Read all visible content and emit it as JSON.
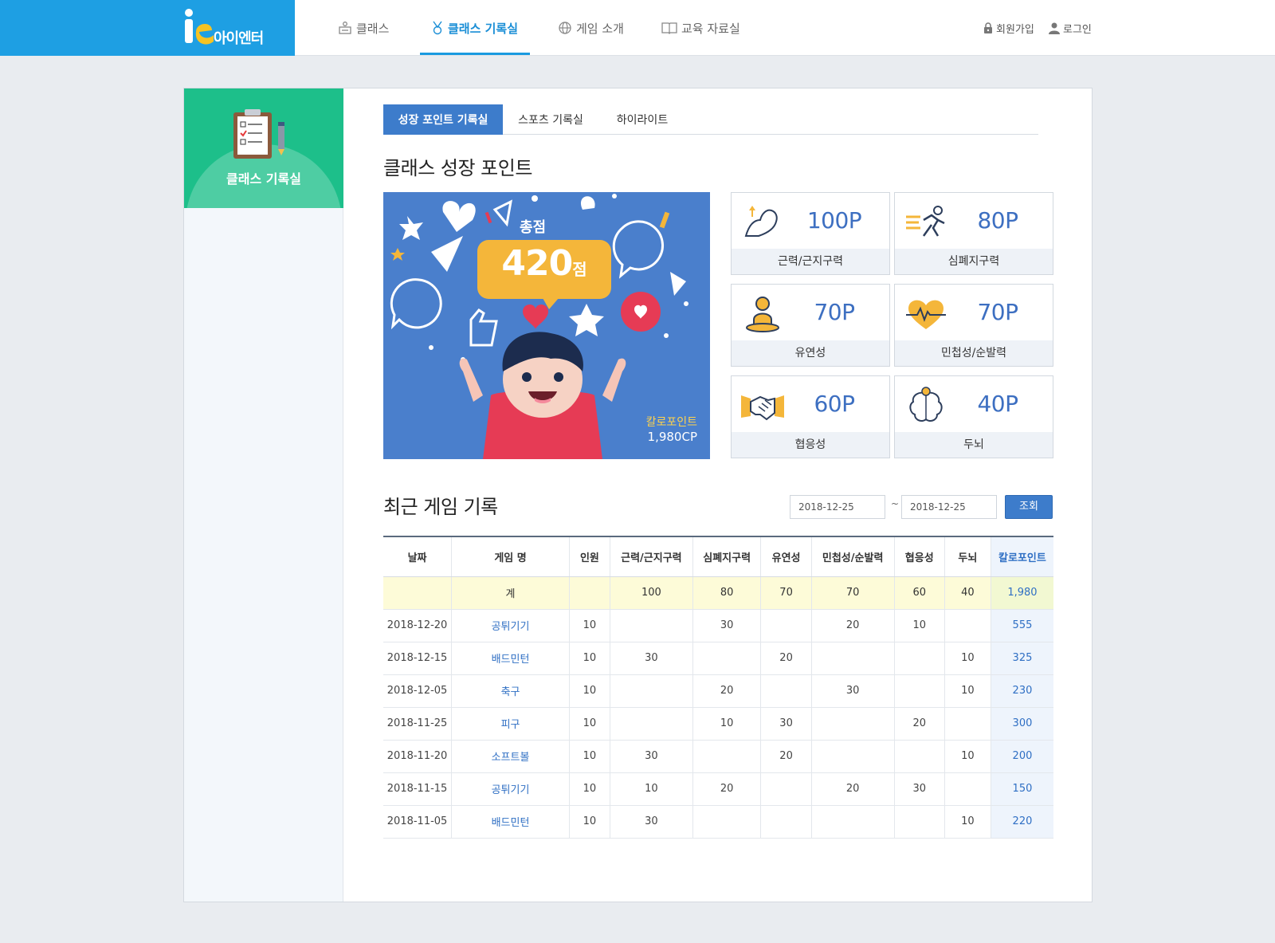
{
  "header": {
    "logo_text": "아이엔터",
    "nav": [
      {
        "label": "클래스",
        "icon": "classroom-icon"
      },
      {
        "label": "클래스 기록실",
        "icon": "medal-icon"
      },
      {
        "label": "게임 소개",
        "icon": "globe-icon"
      },
      {
        "label": "교육 자료실",
        "icon": "book-icon"
      }
    ],
    "util": {
      "signup": "회원가입",
      "login": "로그인"
    }
  },
  "sidebar": {
    "title": "클래스 기록실"
  },
  "tabs": [
    "성장 포인트 기록실",
    "스포츠 기록실",
    "하이라이트"
  ],
  "growth": {
    "title": "클래스 성장 포인트",
    "hero": {
      "total_label": "총점",
      "total_value": "420",
      "total_unit": "점",
      "cp_label": "칼로포인트",
      "cp_value": "1,980CP"
    },
    "stats": [
      {
        "value": "100P",
        "label": "근력/근지구력",
        "icon": "muscle-icon"
      },
      {
        "value": "80P",
        "label": "심폐지구력",
        "icon": "runner-icon"
      },
      {
        "value": "70P",
        "label": "유연성",
        "icon": "yoga-icon"
      },
      {
        "value": "70P",
        "label": "민첩성/순발력",
        "icon": "heartbeat-icon"
      },
      {
        "value": "60P",
        "label": "협응성",
        "icon": "handshake-icon"
      },
      {
        "value": "40P",
        "label": "두뇌",
        "icon": "brain-icon"
      }
    ]
  },
  "records": {
    "title": "최근 게임 기록",
    "date_from": "2018-12-25",
    "date_separator": "~",
    "date_to": "2018-12-25",
    "search_label": "조회",
    "columns": [
      "날짜",
      "게임 명",
      "인원",
      "근력/근지구력",
      "심폐지구력",
      "유연성",
      "민첩성/순발력",
      "협응성",
      "두뇌",
      "칼로포인트"
    ],
    "total": [
      "",
      "계",
      "",
      "100",
      "80",
      "70",
      "70",
      "60",
      "40",
      "1,980"
    ],
    "rows": [
      [
        "2018-12-20",
        "공튀기기",
        "10",
        "",
        "30",
        "",
        "20",
        "10",
        "",
        "555"
      ],
      [
        "2018-12-15",
        "배드민턴",
        "10",
        "30",
        "",
        "20",
        "",
        "",
        "10",
        "325"
      ],
      [
        "2018-12-05",
        "축구",
        "10",
        "",
        "20",
        "",
        "30",
        "",
        "10",
        "230"
      ],
      [
        "2018-11-25",
        "피구",
        "10",
        "",
        "10",
        "30",
        "",
        "20",
        "",
        "300"
      ],
      [
        "2018-11-20",
        "소프트볼",
        "10",
        "30",
        "",
        "20",
        "",
        "",
        "10",
        "200"
      ],
      [
        "2018-11-15",
        "공튀기기",
        "10",
        "10",
        "20",
        "",
        "20",
        "30",
        "",
        "150"
      ],
      [
        "2018-11-05",
        "배드민턴",
        "10",
        "30",
        "",
        "",
        "",
        "",
        "10",
        "220"
      ]
    ]
  },
  "colors": {
    "brand": "#1e9fe3",
    "accent": "#3d7ccb",
    "sidebar": "#1dbf8a",
    "hero_bg": "#4a7fcc",
    "score_bubble": "#f4b63a"
  }
}
